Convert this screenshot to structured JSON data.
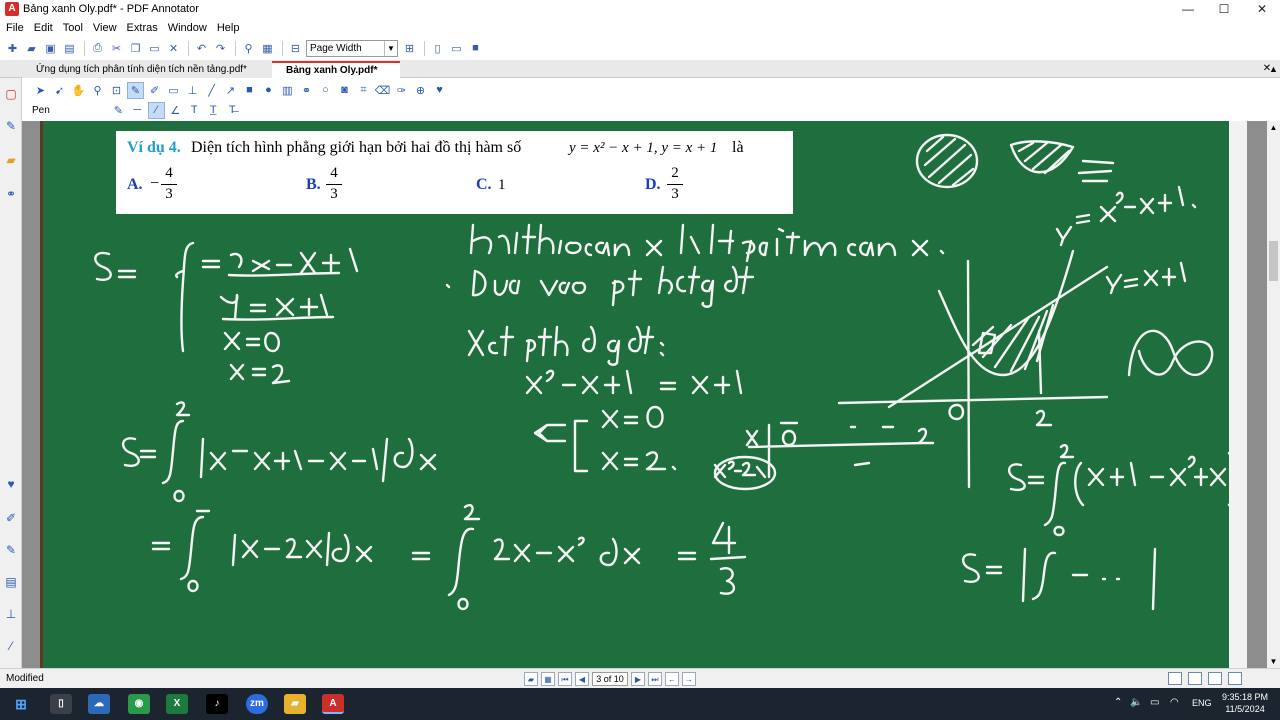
{
  "window": {
    "title": "Bảng xanh Oly.pdf* - PDF Annotator",
    "minimize": "—",
    "maximize": "☐",
    "close": "✕"
  },
  "menu": [
    "File",
    "Edit",
    "Tool",
    "View",
    "Extras",
    "Window",
    "Help"
  ],
  "toolbar": {
    "zoom_mode": "Page Width"
  },
  "tabs": [
    {
      "label": "Ứng dụng tích phân tính diện tích nền tảng.pdf*",
      "active": false
    },
    {
      "label": "Bảng xanh Oly.pdf*",
      "active": true
    }
  ],
  "tools": {
    "pen_label": "Pen"
  },
  "question": {
    "label": "Ví dụ 4.",
    "text": "Diện tích hình phẳng giới hạn bởi hai đồ thị hàm số",
    "formula": "y = x² − x + 1, y = x + 1",
    "suffix": "là",
    "options": [
      {
        "letter": "A.",
        "sign": "−",
        "num": "4",
        "den": "3"
      },
      {
        "letter": "B.",
        "sign": "",
        "num": "4",
        "den": "3"
      },
      {
        "letter": "C.",
        "value": "1"
      },
      {
        "letter": "D.",
        "sign": "",
        "num": "2",
        "den": "3"
      }
    ]
  },
  "status": {
    "text": "Modified",
    "page_indicator": "3 of 10"
  },
  "taskbar": {
    "language": "ENG",
    "time": "9:35:18 PM",
    "date": "11/5/2024"
  },
  "colors": {
    "board": "#1f6e3d",
    "chalk": "#f4f4f4",
    "label_blue": "#1fa0c8",
    "option_blue": "#1a3fb5",
    "tab_accent": "#d9342b"
  }
}
